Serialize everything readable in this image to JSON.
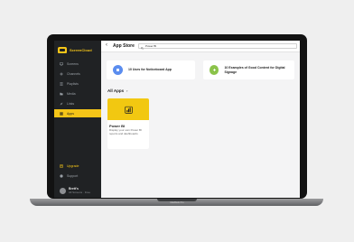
{
  "device": {
    "label": "MacBook Pro"
  },
  "sidebar": {
    "brand": "ScreenCloud",
    "items": [
      {
        "label": "Screens",
        "icon": "monitor-icon"
      },
      {
        "label": "Channels",
        "icon": "plus-icon"
      },
      {
        "label": "Playlists",
        "icon": "list-icon"
      },
      {
        "label": "Media",
        "icon": "folder-icon"
      },
      {
        "label": "Links",
        "icon": "link-icon"
      },
      {
        "label": "Apps",
        "icon": "grid-icon",
        "active": true
      }
    ],
    "bottom_items": [
      {
        "label": "Upgrade",
        "icon": "upgrade-icon"
      },
      {
        "label": "Support",
        "icon": "help-icon"
      }
    ],
    "user": {
      "name": "Brett's",
      "sub": "All Screens · Free"
    }
  },
  "header": {
    "title": "App Store",
    "search_value": "Power BI"
  },
  "featured": [
    {
      "title": "10 Uses for Noticeboard App",
      "color": "#5b8def"
    },
    {
      "title": "10 Examples of Good Content for Digital Signage",
      "color": "#8bc34a"
    }
  ],
  "section": {
    "title": "All Apps"
  },
  "app": {
    "name": "Power BI",
    "description": "Display your own Power BI reports and dashboards",
    "banner_color": "#f2c811"
  },
  "colors": {
    "accent": "#f5c518",
    "sidebar": "#202224"
  }
}
